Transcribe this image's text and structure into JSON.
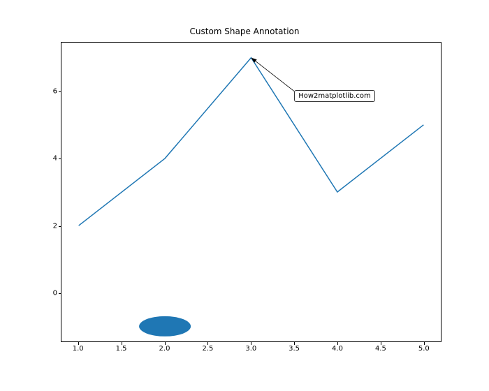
{
  "chart_data": {
    "type": "line",
    "title": "Custom Shape Annotation",
    "x": [
      1,
      2,
      3,
      4,
      5
    ],
    "y": [
      2,
      4,
      7,
      3,
      5
    ],
    "xlim": [
      0.8,
      5.2
    ],
    "ylim": [
      -1.45,
      7.45
    ],
    "xticks": [
      1.0,
      1.5,
      2.0,
      2.5,
      3.0,
      3.5,
      4.0,
      4.5,
      5.0
    ],
    "yticks": [
      0,
      2,
      4,
      6
    ],
    "xtick_labels": [
      "1.0",
      "1.5",
      "2.0",
      "2.5",
      "3.0",
      "3.5",
      "4.0",
      "4.5",
      "5.0"
    ],
    "ytick_labels": [
      "0",
      "2",
      "4",
      "6"
    ],
    "line_color": "#1f77b4",
    "annotation": {
      "text": "How2matplotlib.com",
      "xy": [
        3,
        7
      ],
      "xytext": [
        3.5,
        6
      ],
      "arrow": true
    },
    "shape": {
      "type": "ellipse",
      "cx": 2,
      "cy": -1,
      "rx_data": 0.3,
      "ry_data": 0.3,
      "color": "#1f77b4"
    },
    "xlabel": "",
    "ylabel": ""
  }
}
